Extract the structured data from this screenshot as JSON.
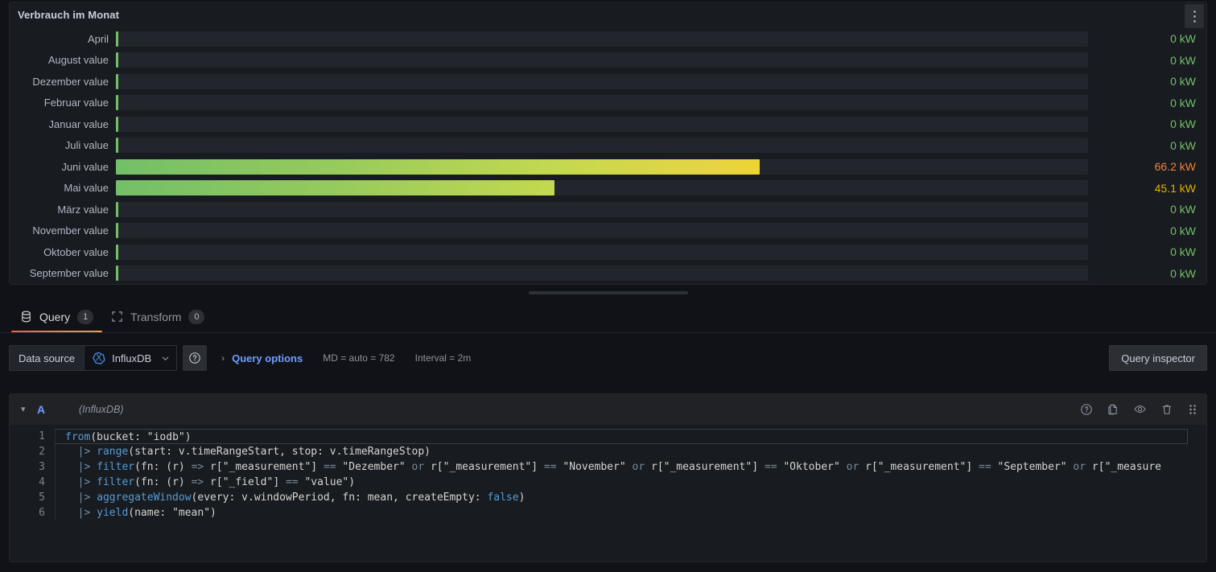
{
  "panel": {
    "title": "Verbrauch im Monat",
    "menu_icon": "kebab-menu-icon",
    "unit": "kW",
    "max": 100
  },
  "chart_data": {
    "type": "bar",
    "title": "Verbrauch im Monat",
    "xlabel": "",
    "ylabel": "",
    "unit": "kW",
    "orientation": "horizontal",
    "display": "bar gauge (LCD/gradient)",
    "gradient": [
      "#73bf69",
      "#96ca5c",
      "#c3d94f",
      "#e8d442",
      "#f5d313",
      "#f2b73d",
      "#ef8e3a"
    ],
    "xlim": [
      0,
      100
    ],
    "grid": false,
    "legend": "none",
    "categories": [
      "April",
      "August value",
      "Dezember value",
      "Februar value",
      "Januar value",
      "Juli value",
      "Juni value",
      "Mai value",
      "März value",
      "November value",
      "Oktober value",
      "September value"
    ],
    "values": [
      0,
      0,
      0,
      0,
      0,
      0,
      66.2,
      45.1,
      0,
      0,
      0,
      0
    ],
    "value_labels": [
      "0 kW",
      "0 kW",
      "0 kW",
      "0 kW",
      "0 kW",
      "0 kW",
      "66.2 kW",
      "45.1 kW",
      "0 kW",
      "0 kW",
      "0 kW",
      "0 kW"
    ],
    "value_colors": [
      "#73bf69",
      "#73bf69",
      "#73bf69",
      "#73bf69",
      "#73bf69",
      "#73bf69",
      "#ef843c",
      "#e0b400",
      "#73bf69",
      "#73bf69",
      "#73bf69",
      "#73bf69"
    ]
  },
  "tabs": [
    {
      "label": "Query",
      "badge": "1",
      "icon": "database-icon",
      "active": true
    },
    {
      "label": "Transform",
      "badge": "0",
      "icon": "transform-icon",
      "active": false
    }
  ],
  "datasource": {
    "label": "Data source",
    "name": "InfluxDB",
    "icon": "influxdb-icon",
    "caret_icon": "chevron-down-icon",
    "help_icon": "help-circle-icon"
  },
  "query_options": {
    "caret_icon": "chevron-right-icon",
    "label": "Query options",
    "max_data_points": "MD = auto = 782",
    "interval": "Interval = 2m"
  },
  "query_inspector": {
    "label": "Query inspector"
  },
  "query_editor": {
    "caret_icon": "chevron-down-icon",
    "ref_id": "A",
    "datasource_note": "(InfluxDB)",
    "actions": [
      {
        "icon": "help-circle-icon",
        "name": "query-help-button"
      },
      {
        "icon": "copy-icon",
        "name": "duplicate-query-button"
      },
      {
        "icon": "eye-icon",
        "name": "toggle-query-visibility-button"
      },
      {
        "icon": "trash-icon",
        "name": "remove-query-button"
      },
      {
        "icon": "drag-handle-icon",
        "name": "drag-query-handle"
      }
    ],
    "lines": [
      {
        "n": "1",
        "text": "from(bucket: \"iodb\")"
      },
      {
        "n": "2",
        "text": "  |> range(start: v.timeRangeStart, stop: v.timeRangeStop)"
      },
      {
        "n": "3",
        "text": "  |> filter(fn: (r) => r[\"_measurement\"] == \"Dezember\" or r[\"_measurement\"] == \"November\" or r[\"_measurement\"] == \"Oktober\" or r[\"_measurement\"] == \"September\" or r[\"_measure"
      },
      {
        "n": "4",
        "text": "  |> filter(fn: (r) => r[\"_field\"] == \"value\")"
      },
      {
        "n": "5",
        "text": "  |> aggregateWindow(every: v.windowPeriod, fn: mean, createEmpty: false)"
      },
      {
        "n": "6",
        "text": "  |> yield(name: \"mean\")"
      }
    ]
  }
}
